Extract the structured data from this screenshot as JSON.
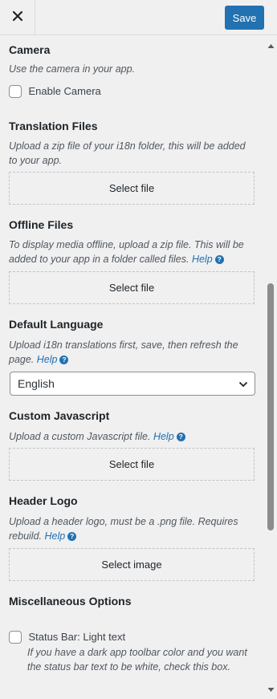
{
  "header": {
    "save_label": "Save"
  },
  "camera": {
    "title": "Camera",
    "description": "Use the camera in your app.",
    "checkbox_label": "Enable Camera"
  },
  "translation": {
    "title": "Translation Files",
    "description_line1": "Upload a zip file of your i18n folder, this will be added",
    "description_line2": "to your app.",
    "button": "Select file"
  },
  "offline": {
    "title": "Offline Files",
    "description_line1": "To display media offline, upload a zip file. This will be",
    "description_line2": "added to your app in a folder called files.",
    "help": "Help",
    "button": "Select file"
  },
  "language": {
    "title": "Default Language",
    "description_line1": "Upload i18n translations first, save, then refresh the",
    "description_line2": "page.",
    "help": "Help",
    "selected": "English"
  },
  "javascript": {
    "title": "Custom Javascript",
    "description": "Upload a custom Javascript file.",
    "help": "Help",
    "button": "Select file"
  },
  "header_logo": {
    "title": "Header Logo",
    "description_line1": "Upload a header logo, must be a .png file. Requires",
    "description_line2": "rebuild.",
    "help": "Help",
    "button": "Select image"
  },
  "misc": {
    "title": "Miscellaneous Options",
    "status_bar_label": "Status Bar: Light text",
    "status_bar_desc_line1": "If you have a dark app toolbar color and you want",
    "status_bar_desc_line2": "the status bar text to be white, check this box."
  },
  "icons": {
    "close": "close-icon",
    "help": "help-circle-icon",
    "dropdown": "chevron-down-icon"
  },
  "colors": {
    "accent": "#2271b1",
    "background": "#f0f0f1"
  }
}
